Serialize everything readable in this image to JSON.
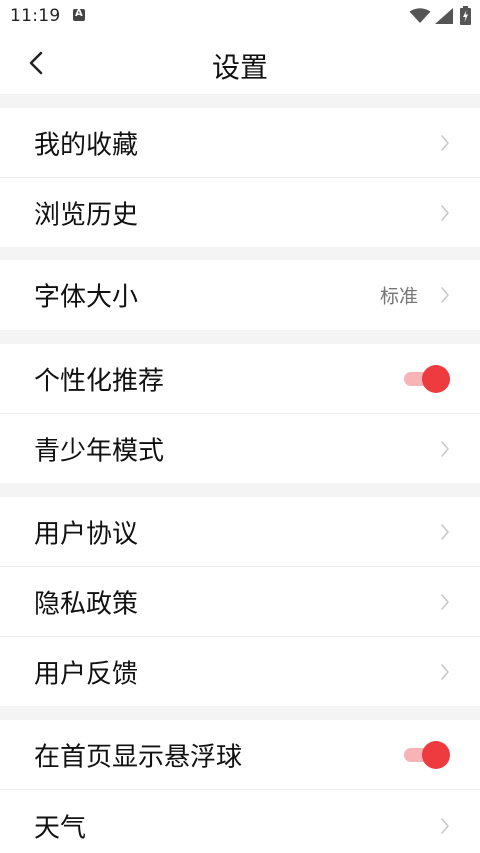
{
  "status_bar": {
    "time": "11:19",
    "notification_icon": "a-notification-icon",
    "wifi_icon": "wifi-icon",
    "signal_icon": "cell-signal-icon",
    "battery_icon": "battery-charging-icon"
  },
  "header": {
    "back_icon": "chevron-left-icon",
    "title": "设置"
  },
  "sections": [
    {
      "items": [
        {
          "label": "我的收藏",
          "type": "link"
        },
        {
          "label": "浏览历史",
          "type": "link"
        }
      ]
    },
    {
      "items": [
        {
          "label": "字体大小",
          "type": "link",
          "value": "标准"
        }
      ]
    },
    {
      "items": [
        {
          "label": "个性化推荐",
          "type": "toggle",
          "on": true
        },
        {
          "label": "青少年模式",
          "type": "link"
        }
      ]
    },
    {
      "items": [
        {
          "label": "用户协议",
          "type": "link"
        },
        {
          "label": "隐私政策",
          "type": "link"
        },
        {
          "label": "用户反馈",
          "type": "link"
        }
      ]
    },
    {
      "items": [
        {
          "label": "在首页显示悬浮球",
          "type": "toggle",
          "on": true
        },
        {
          "label": "天气",
          "type": "link"
        }
      ]
    }
  ],
  "colors": {
    "accent": "#ee3b3f",
    "accent_track": "#f7b3b6",
    "section_gap": "#f4f4f4",
    "chevron": "#c8c8c8"
  }
}
